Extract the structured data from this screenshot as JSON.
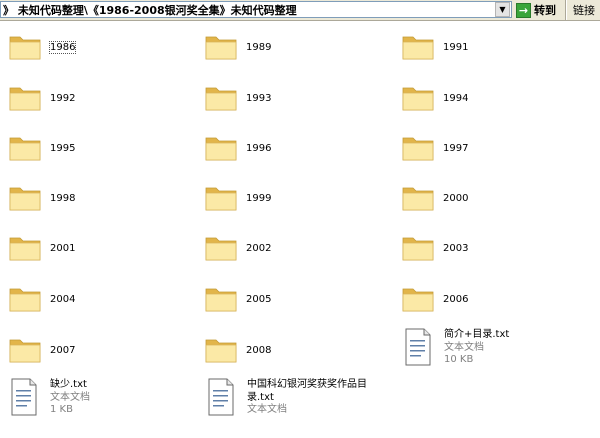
{
  "address_bar": {
    "path": "》 未知代码整理\\《1986-2008银河奖全集》未知代码整理",
    "go_label": "转到",
    "links_label": "链接"
  },
  "folders": [
    {
      "name": "1986",
      "selected": true
    },
    {
      "name": "1989"
    },
    {
      "name": "1991"
    },
    {
      "name": "1992"
    },
    {
      "name": "1993"
    },
    {
      "name": "1994"
    },
    {
      "name": "1995"
    },
    {
      "name": "1996"
    },
    {
      "name": "1997"
    },
    {
      "name": "1998"
    },
    {
      "name": "1999"
    },
    {
      "name": "2000"
    },
    {
      "name": "2001"
    },
    {
      "name": "2002"
    },
    {
      "name": "2003"
    },
    {
      "name": "2004"
    },
    {
      "name": "2005"
    },
    {
      "name": "2006"
    },
    {
      "name": "2007"
    },
    {
      "name": "2008"
    }
  ],
  "files": [
    {
      "name": "简介+目录.txt",
      "type": "文本文档",
      "size": "10 KB"
    },
    {
      "name": "缺少.txt",
      "type": "文本文档",
      "size": "1 KB"
    },
    {
      "name_line1": "中国科幻银河奖获奖作品目",
      "name_line2": "录.txt",
      "type": "文本文档"
    }
  ],
  "colors": {
    "folder_light": "#fbe9a6",
    "folder_dark": "#e2b54a",
    "go_green": "#3aa53a"
  }
}
